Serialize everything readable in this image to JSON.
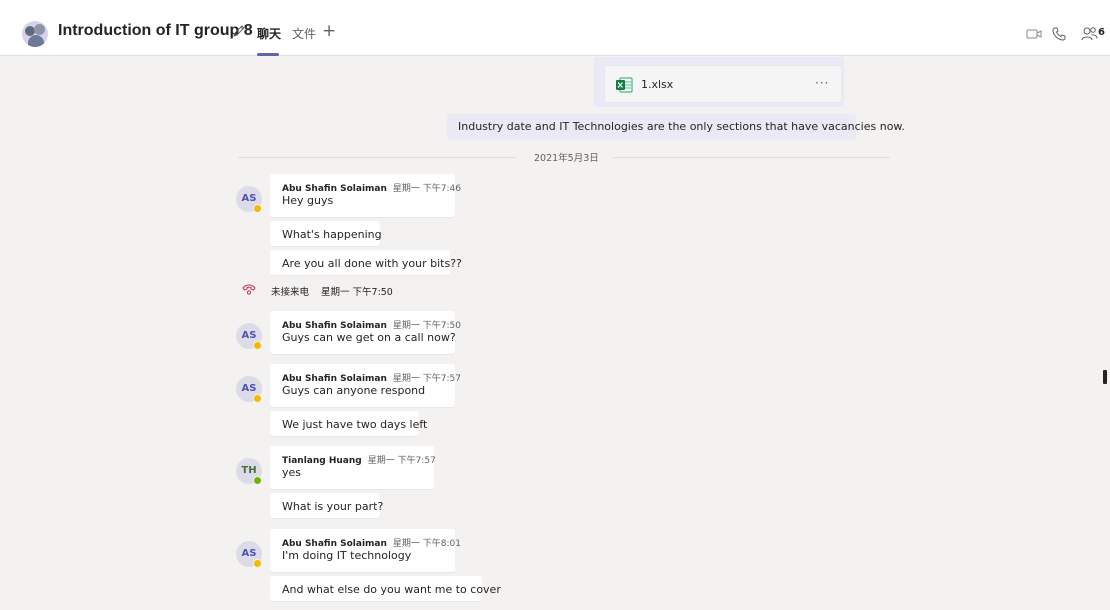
{
  "header": {
    "title": "Introduction of IT group 8",
    "tabs": [
      {
        "label": "聊天",
        "active": true
      },
      {
        "label": "文件",
        "active": false
      }
    ],
    "add_tab": "+",
    "participants_count": "6"
  },
  "file_attachment": {
    "name": "1.xlsx",
    "more": "···"
  },
  "outgoing_message": "Industry date and IT Technologies are the only sections that have vacancies now.",
  "date_separator": "2021年5月3日",
  "messages": [
    {
      "initials": "AS",
      "author": "Abu Shafin Solaiman",
      "time": "星期一 下午7:46",
      "lines": [
        "Hey guys",
        "What's happening",
        "Are you all done with your bits??"
      ]
    },
    {
      "initials": "AS",
      "author": "Abu Shafin Solaiman",
      "time": "星期一 下午7:50",
      "lines": [
        "Guys can we get on a call now?"
      ]
    },
    {
      "initials": "AS",
      "author": "Abu Shafin Solaiman",
      "time": "星期一 下午7:57",
      "lines": [
        "Guys can anyone respond",
        "We just have two days left"
      ]
    },
    {
      "initials": "TH",
      "author": "Tianlang Huang",
      "time": "星期一 下午7:57",
      "lines": [
        "yes",
        "What is your part?"
      ]
    },
    {
      "initials": "AS",
      "author": "Abu Shafin Solaiman",
      "time": "星期一 下午8:01",
      "lines": [
        "I'm doing IT technology",
        "And what else do you want me to cover"
      ]
    }
  ],
  "missed_call": {
    "label": "未接来电",
    "time": "星期一 下午7:50"
  },
  "colors": {
    "accent": "#6264a7",
    "background": "#f3f2f1",
    "outgoing_bubble": "#e9eaf6",
    "away": "#f8b800",
    "online": "#6bb700",
    "missed_call": "#c4314b"
  },
  "icons": [
    "group-avatar",
    "edit-icon",
    "video-call-icon",
    "audio-call-icon",
    "people-icon",
    "excel-file-icon",
    "missed-call-icon"
  ]
}
